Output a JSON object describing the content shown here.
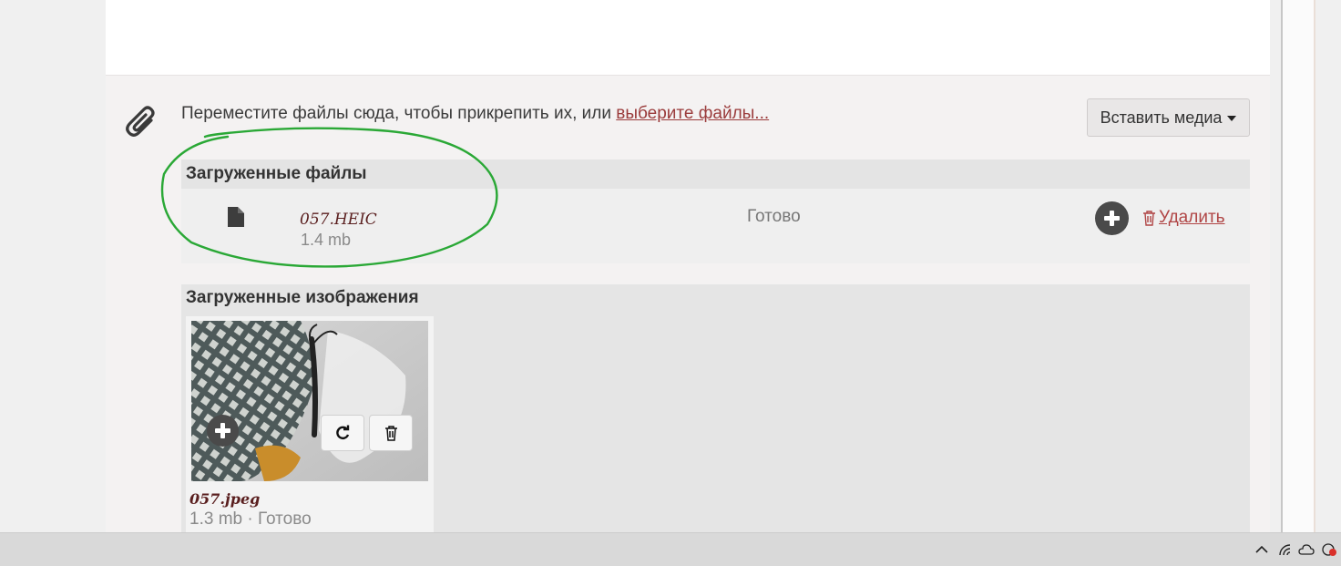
{
  "dropzone": {
    "text": "Переместите файлы сюда, чтобы прикрепить их, или ",
    "link": "выберите файлы...",
    "insert_media_label": "Вставить медиа"
  },
  "uploaded_files": {
    "header": "Загруженные файлы",
    "items": [
      {
        "name": "057.HEIC",
        "size": "1.4 mb",
        "status": "Готово",
        "delete_label": "Удалить"
      }
    ]
  },
  "uploaded_images": {
    "header": "Загруженные изображения",
    "items": [
      {
        "name": "057.jpeg",
        "meta": "1.3 mb · Готово"
      }
    ]
  },
  "colors": {
    "link": "#9a3b3b",
    "delete": "#b04545",
    "annotation": "#2aa836",
    "panel": "#f4f2f2"
  },
  "icons": [
    "paperclip-icon",
    "file-icon",
    "plus-icon",
    "trash-icon",
    "refresh-icon",
    "chevron-up-icon",
    "wifi-icon",
    "cloud-icon",
    "notification-icon"
  ]
}
